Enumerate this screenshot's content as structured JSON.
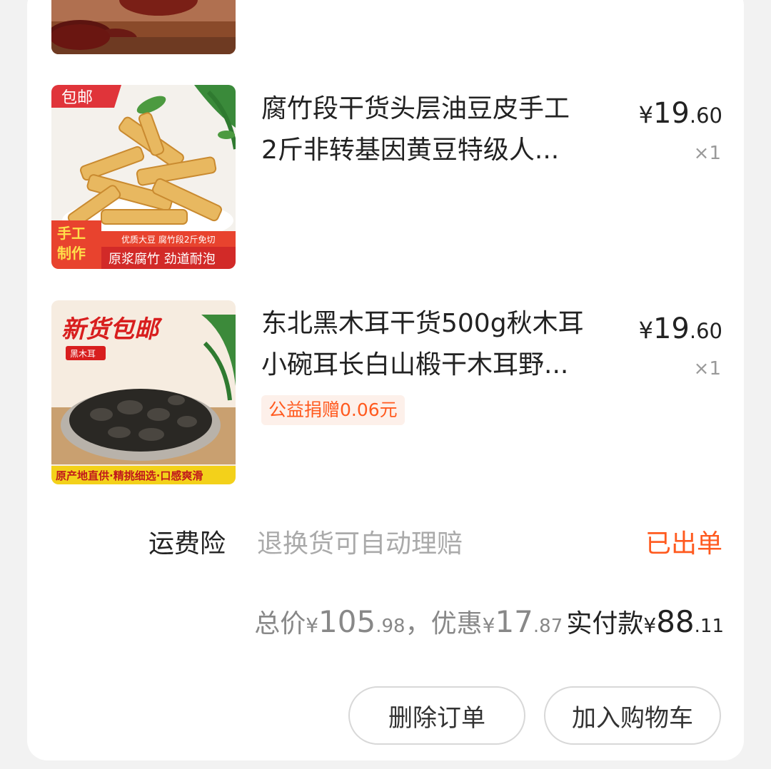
{
  "order": {
    "items": [
      {
        "title_line1": "腐竹段干货头层油豆皮手工",
        "title_line2": "2斤非转基因黄豆特级人...",
        "price_symbol": "¥",
        "price_int": "19",
        "price_dec": ".60",
        "qty": "×1",
        "image": {
          "badge": "包邮",
          "side_label_1": "手工",
          "side_label_2": "制作",
          "caption_small": "优质大豆 腐竹段2斤免切",
          "caption_main": "原浆腐竹 劲道耐泡"
        }
      },
      {
        "title_line1": "东北黑木耳干货500g秋木耳",
        "title_line2": "小碗耳长白山椴干木耳野...",
        "price_symbol": "¥",
        "price_int": "19",
        "price_dec": ".60",
        "qty": "×1",
        "donation": "公益捐赠0.06元",
        "image": {
          "headline": "新货包邮",
          "tag": "黑木耳",
          "caption": "原产地直供·精挑细选·口感爽滑"
        }
      }
    ],
    "shipping_insurance": {
      "label": "运费险",
      "description": "退换货可自动理赔",
      "status": "已出单"
    },
    "summary": {
      "total_label": "总价",
      "total_int": "105",
      "total_dec": ".98",
      "separator": "，",
      "discount_label": "优惠",
      "discount_int": "17",
      "discount_dec": ".87",
      "paid_label": "实付款",
      "paid_int": "88",
      "paid_dec": ".11",
      "symbol": "¥"
    },
    "actions": {
      "delete_label": "删除订单",
      "add_cart_label": "加入购物车"
    }
  },
  "colors": {
    "accent": "#ff5a1f",
    "text": "#222222",
    "muted": "#999999"
  }
}
